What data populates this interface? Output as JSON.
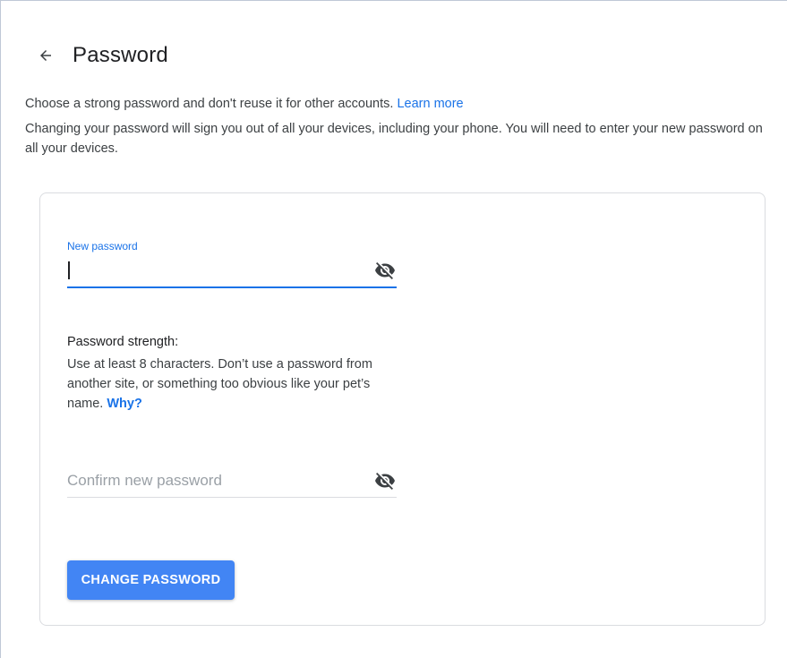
{
  "header": {
    "title": "Password"
  },
  "intro": {
    "line1": "Choose a strong password and don't reuse it for other accounts. ",
    "learn_more": "Learn more",
    "line2": "Changing your password will sign you out of all your devices, including your phone. You will need to enter your new password on all your devices."
  },
  "form": {
    "new_password": {
      "label": "New password",
      "value": "",
      "icon": "eye-off-icon"
    },
    "strength": {
      "title": "Password strength:",
      "description": "Use at least 8 characters. Don’t use a password from another site, or something too obvious like your pet’s name. ",
      "why_link": "Why?"
    },
    "confirm_password": {
      "placeholder": "Confirm new password",
      "value": "",
      "icon": "eye-off-icon"
    },
    "submit_label": "CHANGE PASSWORD"
  },
  "colors": {
    "accent": "#1a73e8",
    "button": "#4285f4",
    "border": "#dadce0"
  }
}
